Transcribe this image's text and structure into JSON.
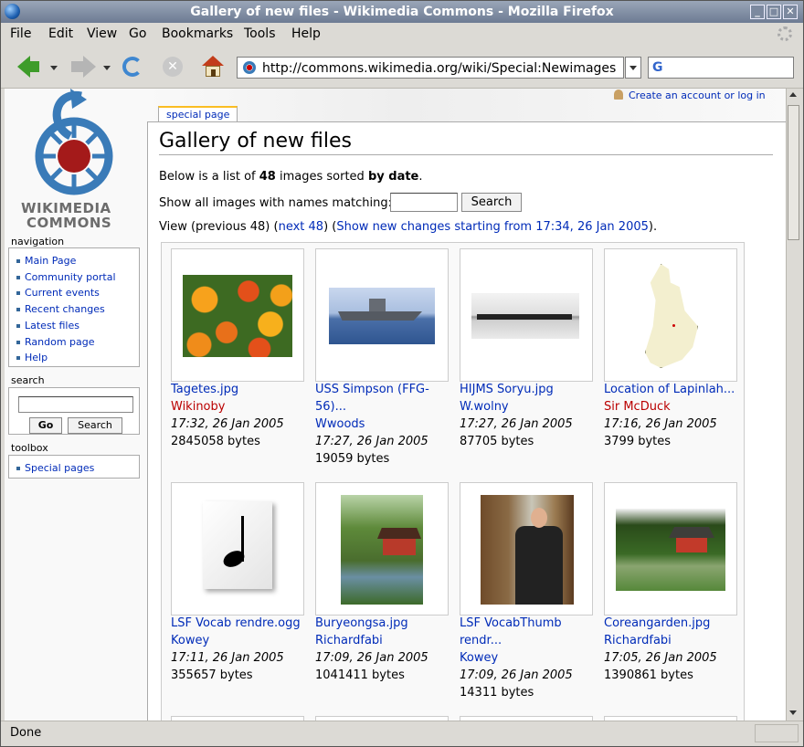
{
  "window": {
    "title": "Gallery of new files - Wikimedia Commons - Mozilla Firefox",
    "min_label": "_",
    "max_label": "□",
    "close_label": "✕"
  },
  "menubar": {
    "file": "File",
    "edit": "Edit",
    "view": "View",
    "go": "Go",
    "bookmarks": "Bookmarks",
    "tools": "Tools",
    "help": "Help"
  },
  "toolbar": {
    "url": "http://commons.wikimedia.org/wiki/Special:Newimages",
    "search_engine_glyph": "G",
    "stop_glyph": "✕"
  },
  "sidebar": {
    "logo_line1": "WIKIMEDIA",
    "logo_line2": "COMMONS",
    "navigation_heading": "navigation",
    "navigation": [
      "Main Page",
      "Community portal",
      "Current events",
      "Recent changes",
      "Latest files",
      "Random page",
      "Help"
    ],
    "search_heading": "search",
    "go_label": "Go",
    "search_label": "Search",
    "toolbox_heading": "toolbox",
    "toolbox": [
      "Special pages"
    ]
  },
  "page": {
    "user_link": "Create an account or log in",
    "tab": "special page",
    "heading": "Gallery of new files",
    "intro_pre": "Below is a list of ",
    "intro_count": "48",
    "intro_mid": " images sorted ",
    "intro_by": "by date",
    "intro_end": ".",
    "filter_label": "Show all images with names matching:",
    "filter_button": "Search",
    "view_pre": "View (previous 48) (",
    "next_link": "next 48",
    "view_mid": ") (",
    "changes_link": "Show new changes starting from 17:34, 26 Jan 2005",
    "view_end": ")."
  },
  "gallery": [
    {
      "file": "Tagetes.jpg",
      "user": "Wikinoby",
      "user_new": true,
      "date": "17:32, 26 Jan 2005",
      "size": "2845058 bytes"
    },
    {
      "file": "USS Simpson (FFG-56)...",
      "user": "Wwoods",
      "user_new": false,
      "date": "17:27, 26 Jan 2005",
      "size": "19059 bytes"
    },
    {
      "file": "HIJMS Soryu.jpg",
      "user": "W.wolny",
      "user_new": false,
      "date": "17:27, 26 Jan 2005",
      "size": "87705 bytes"
    },
    {
      "file": "Location of Lapinlah...",
      "user": "Sir McDuck",
      "user_new": true,
      "date": "17:16, 26 Jan 2005",
      "size": "3799 bytes"
    },
    {
      "file": "LSF Vocab rendre.ogg",
      "user": "Kowey",
      "user_new": false,
      "date": "17:11, 26 Jan 2005",
      "size": "355657 bytes"
    },
    {
      "file": "Buryeongsa.jpg",
      "user": "Richardfabi",
      "user_new": false,
      "date": "17:09, 26 Jan 2005",
      "size": "1041411 bytes"
    },
    {
      "file": "LSF VocabThumb rendr...",
      "user": "Kowey",
      "user_new": false,
      "date": "17:09, 26 Jan 2005",
      "size": "14311 bytes"
    },
    {
      "file": "Coreangarden.jpg",
      "user": "Richardfabi",
      "user_new": false,
      "date": "17:05, 26 Jan 2005",
      "size": "1390861 bytes"
    }
  ],
  "status": {
    "text": "Done"
  },
  "colors": {
    "link": "#002bb8",
    "new_link": "#ba0000",
    "tab_accent": "#fabd23"
  }
}
